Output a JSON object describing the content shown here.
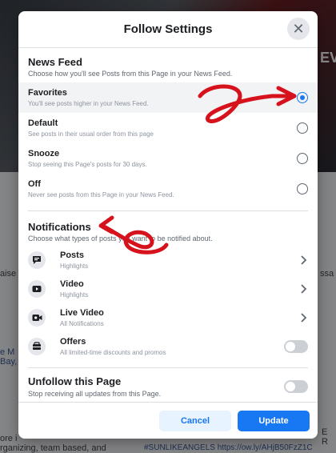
{
  "background": {
    "left_texts": [
      "aise",
      "e M",
      "Bay,",
      "ore i",
      "rganizing, team based, and"
    ],
    "right_texts": [
      "ssa",
      "EVE",
      "E R",
      "#SUNLIKEANGELS https://ow.ly/AHjB50FzZ1C"
    ]
  },
  "modal": {
    "title": "Follow Settings",
    "close_label": "✕",
    "news_feed": {
      "title": "News Feed",
      "subtitle": "Choose how you'll see Posts from this Page in your News Feed.",
      "options": [
        {
          "title": "Favorites",
          "subtitle": "You'll see posts higher in your News Feed.",
          "selected": true
        },
        {
          "title": "Default",
          "subtitle": "See posts in their usual order from this page",
          "selected": false
        },
        {
          "title": "Snooze",
          "subtitle": "Stop seeing this Page's posts for 30 days.",
          "selected": false
        },
        {
          "title": "Off",
          "subtitle": "Never see posts from this Page in your News Feed.",
          "selected": false
        }
      ]
    },
    "notifications": {
      "title": "Notifications",
      "subtitle": "Choose what types of posts you want to be notified about.",
      "items": [
        {
          "title": "Posts",
          "subtitle": "Highlights",
          "icon": "post-icon",
          "control": "chevron"
        },
        {
          "title": "Video",
          "subtitle": "Highlights",
          "icon": "video-icon",
          "control": "chevron"
        },
        {
          "title": "Live Video",
          "subtitle": "All Notifications",
          "icon": "live-video-icon",
          "control": "chevron"
        },
        {
          "title": "Offers",
          "subtitle": "All limited-time discounts and promos",
          "icon": "offers-icon",
          "control": "toggle",
          "on": false
        }
      ]
    },
    "unfollow": {
      "title": "Unfollow this Page",
      "subtitle": "Stop receiving all updates from this Page.",
      "on": false
    },
    "footer": {
      "cancel_label": "Cancel",
      "update_label": "Update"
    }
  },
  "colors": {
    "accent": "#1877f2",
    "annotation": "#d6121c"
  }
}
